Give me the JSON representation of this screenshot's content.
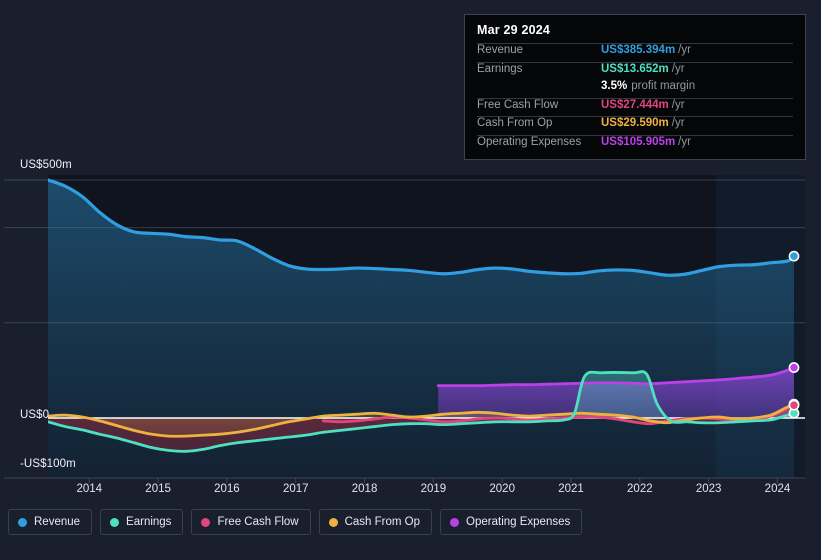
{
  "axis": {
    "y_labels": [
      {
        "text": "US$500m",
        "value": 500
      },
      {
        "text": "US$0",
        "value": 0
      },
      {
        "text": "-US$100m",
        "value": -100
      }
    ],
    "x_labels": [
      "2014",
      "2015",
      "2016",
      "2017",
      "2018",
      "2019",
      "2020",
      "2021",
      "2022",
      "2023",
      "2024"
    ]
  },
  "tooltip": {
    "date": "Mar 29 2024",
    "rows": [
      {
        "key": "Revenue",
        "value": "US$385.394m",
        "unit": "/yr",
        "color": "#2f9fe0"
      },
      {
        "key": "Earnings",
        "value": "US$13.652m",
        "unit": "/yr",
        "color": "#4fe0c0"
      },
      {
        "key": "",
        "value": "3.5%",
        "unit": "profit margin",
        "color": "#ffffff",
        "margin": true
      },
      {
        "key": "Free Cash Flow",
        "value": "US$27.444m",
        "unit": "/yr",
        "color": "#e0457b"
      },
      {
        "key": "Cash From Op",
        "value": "US$29.590m",
        "unit": "/yr",
        "color": "#eeb23e"
      },
      {
        "key": "Operating Expenses",
        "value": "US$105.905m",
        "unit": "/yr",
        "color": "#bb40e8"
      }
    ]
  },
  "legend": {
    "items": [
      {
        "label": "Revenue",
        "color": "#2f9fe0"
      },
      {
        "label": "Earnings",
        "color": "#4fe0c0"
      },
      {
        "label": "Free Cash Flow",
        "color": "#e0457b"
      },
      {
        "label": "Cash From Op",
        "color": "#eeb23e"
      },
      {
        "label": "Operating Expenses",
        "color": "#bb40e8"
      }
    ]
  },
  "chart_data": {
    "type": "area",
    "title": "",
    "xlabel": "",
    "ylabel": "",
    "ylim": [
      -100,
      560
    ],
    "xlim": [
      2013.4,
      2024.4
    ],
    "grid": true,
    "currency": "US$ millions",
    "zero_line": 0,
    "forecast_start": 2023.1,
    "legend_position": "bottom",
    "series": [
      {
        "name": "Revenue",
        "color": "#2f9fe0",
        "x": [
          2013.4,
          2013.65,
          2013.9,
          2014.15,
          2014.4,
          2014.65,
          2014.9,
          2015.15,
          2015.4,
          2015.65,
          2015.9,
          2016.15,
          2016.4,
          2016.65,
          2016.9,
          2017.15,
          2017.4,
          2017.65,
          2017.9,
          2018.15,
          2018.4,
          2018.65,
          2018.9,
          2019.15,
          2019.4,
          2019.65,
          2019.9,
          2020.15,
          2020.4,
          2020.65,
          2020.9,
          2021.15,
          2021.4,
          2021.65,
          2021.9,
          2022.15,
          2022.4,
          2022.65,
          2022.9,
          2023.15,
          2023.4,
          2023.65,
          2023.9,
          2024.15,
          2024.24
        ],
        "y": [
          500,
          487,
          465,
          432,
          406,
          391,
          388,
          386,
          381,
          379,
          374,
          372,
          356,
          336,
          320,
          313,
          312,
          313,
          315,
          314,
          312,
          310,
          306,
          303,
          306,
          312,
          315,
          313,
          308,
          305,
          303,
          304,
          309,
          311,
          310,
          305,
          300,
          302,
          310,
          318,
          321,
          322,
          326,
          330,
          340
        ]
      },
      {
        "name": "Earnings",
        "color": "#4fe0c0",
        "x": [
          2013.4,
          2013.65,
          2013.9,
          2014.15,
          2014.4,
          2014.65,
          2014.9,
          2015.15,
          2015.4,
          2015.65,
          2015.9,
          2016.15,
          2016.4,
          2016.65,
          2016.9,
          2017.15,
          2017.4,
          2017.65,
          2017.9,
          2018.15,
          2018.4,
          2018.65,
          2018.9,
          2019.15,
          2019.4,
          2019.65,
          2019.9,
          2020.15,
          2020.4,
          2020.65,
          2020.9,
          2021.05,
          2021.2,
          2021.45,
          2021.9,
          2022.1,
          2022.25,
          2022.45,
          2022.7,
          2022.9,
          2023.15,
          2023.4,
          2023.65,
          2023.9,
          2024.1,
          2024.24
        ],
        "y": [
          -8,
          -18,
          -25,
          -34,
          -42,
          -52,
          -62,
          -68,
          -70,
          -66,
          -58,
          -52,
          -48,
          -44,
          -40,
          -36,
          -30,
          -26,
          -22,
          -18,
          -14,
          -12,
          -12,
          -14,
          -12,
          -10,
          -8,
          -8,
          -8,
          -6,
          -4,
          10,
          88,
          95,
          95,
          92,
          30,
          -6,
          -8,
          -10,
          -10,
          -8,
          -6,
          -4,
          4,
          10
        ]
      },
      {
        "name": "Free Cash Flow",
        "color": "#e0457b",
        "x": [
          2017.4,
          2017.65,
          2017.9,
          2018.15,
          2018.4,
          2018.65,
          2018.9,
          2019.15,
          2019.4,
          2019.65,
          2019.9,
          2020.15,
          2020.4,
          2020.65,
          2020.9,
          2021.15,
          2021.4,
          2021.65,
          2021.9,
          2022.15,
          2022.4,
          2022.65,
          2022.9,
          2023.15,
          2023.4,
          2023.65,
          2023.9,
          2024.1,
          2024.24
        ],
        "y": [
          -6,
          -8,
          -6,
          -2,
          2,
          0,
          -4,
          -8,
          -6,
          -2,
          0,
          -2,
          -4,
          -2,
          0,
          2,
          2,
          -2,
          -8,
          -12,
          -6,
          -2,
          0,
          -2,
          -6,
          -4,
          4,
          16,
          27
        ]
      },
      {
        "name": "Cash From Op",
        "color": "#eeb23e",
        "x": [
          2013.4,
          2013.65,
          2013.9,
          2014.15,
          2014.4,
          2014.65,
          2014.9,
          2015.15,
          2015.4,
          2015.65,
          2015.9,
          2016.15,
          2016.4,
          2016.65,
          2016.9,
          2017.15,
          2017.4,
          2017.65,
          2017.9,
          2018.15,
          2018.4,
          2018.65,
          2018.9,
          2019.15,
          2019.4,
          2019.65,
          2019.9,
          2020.15,
          2020.4,
          2020.65,
          2020.9,
          2021.15,
          2021.4,
          2021.65,
          2021.9,
          2022.15,
          2022.4,
          2022.65,
          2022.9,
          2023.15,
          2023.4,
          2023.65,
          2023.9,
          2024.1,
          2024.24
        ],
        "y": [
          4,
          6,
          2,
          -6,
          -16,
          -26,
          -34,
          -38,
          -38,
          -36,
          -34,
          -30,
          -24,
          -16,
          -8,
          -2,
          4,
          6,
          8,
          10,
          6,
          2,
          4,
          8,
          10,
          12,
          10,
          6,
          4,
          6,
          8,
          10,
          8,
          6,
          2,
          -6,
          -10,
          -4,
          0,
          2,
          -2,
          0,
          6,
          20,
          29
        ]
      },
      {
        "name": "Operating Expenses",
        "color": "#bb40e8",
        "x": [
          2019.07,
          2019.4,
          2019.65,
          2019.9,
          2020.15,
          2020.4,
          2020.65,
          2020.9,
          2021.15,
          2021.4,
          2021.65,
          2021.9,
          2022.15,
          2022.4,
          2022.65,
          2022.9,
          2023.15,
          2023.4,
          2023.65,
          2023.9,
          2024.1,
          2024.24
        ],
        "y": [
          68,
          68,
          68,
          69,
          70,
          70,
          71,
          72,
          73,
          74,
          74,
          73,
          72,
          74,
          76,
          78,
          80,
          83,
          86,
          90,
          98,
          106
        ]
      }
    ]
  }
}
